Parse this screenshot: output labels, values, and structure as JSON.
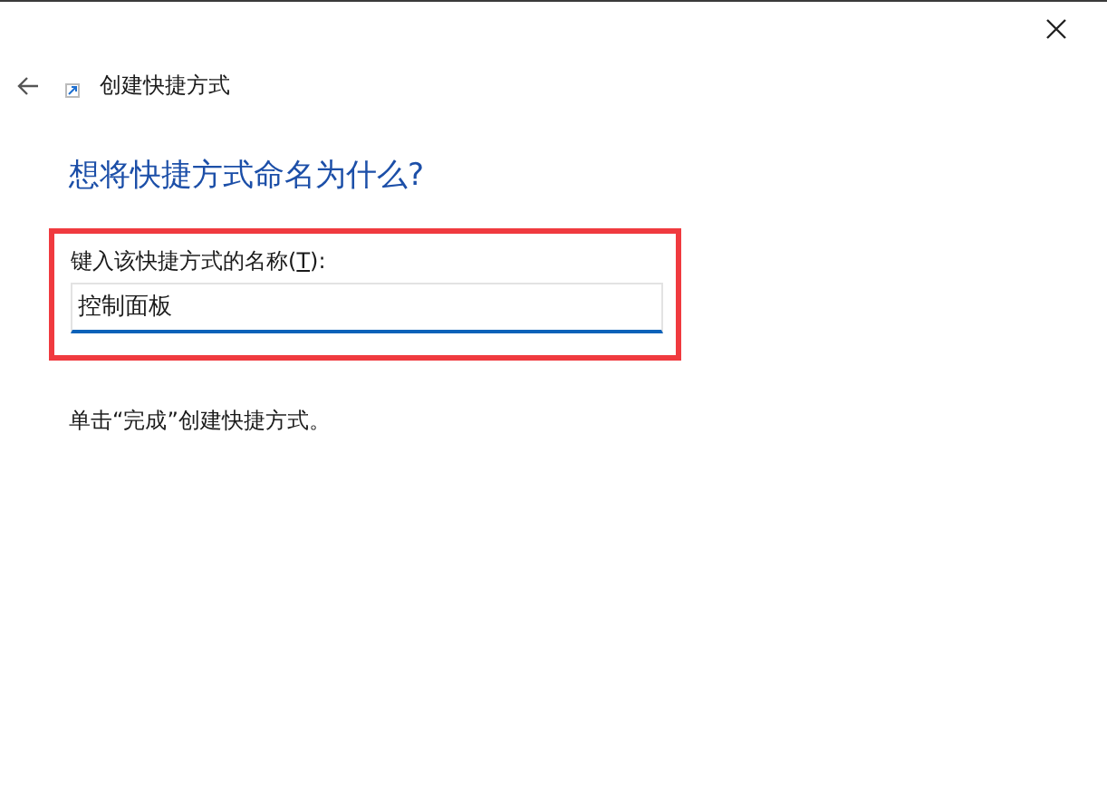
{
  "window": {
    "title": "创建快捷方式"
  },
  "heading": "想将快捷方式命名为什么?",
  "name_field": {
    "label_start": "键入该快捷方式的名称(",
    "access_key": "T",
    "label_end": "):",
    "value": "控制面板",
    "highlighted": true
  },
  "instruction": "单击“完成”创建快捷方式。"
}
